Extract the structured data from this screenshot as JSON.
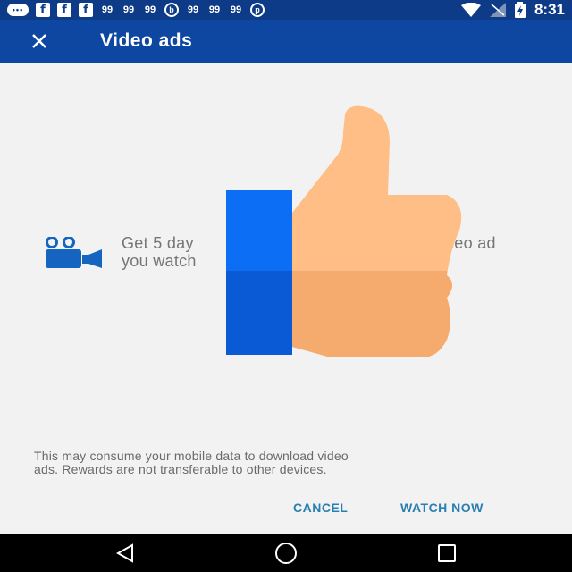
{
  "status_bar": {
    "time": "8:31",
    "icons": [
      "chat-icon",
      "facebook-icon",
      "facebook-icon",
      "facebook-icon",
      "app-icon",
      "app-icon",
      "app-icon",
      "b-icon",
      "app-icon",
      "app-icon",
      "app-icon",
      "pinterest-icon",
      "wifi-icon",
      "signal-icon",
      "battery-icon"
    ]
  },
  "app_bar": {
    "title": "Video ads",
    "close_icon": "close-icon",
    "background": "#0d47a1"
  },
  "offer": {
    "icon": "video-camera-icon",
    "line1": "Get 5 day",
    "line2": "you watch",
    "line1_end": "deo ad"
  },
  "overlay": {
    "icon": "thumbs-up-icon"
  },
  "disclaimer": {
    "line1": "This may consume your mobile data to download video",
    "line2": "ads. Rewards are not transferable to other devices."
  },
  "actions": {
    "cancel_label": "CANCEL",
    "watch_label": "WATCH NOW",
    "accent": "#2a7fb2"
  },
  "nav_bar": {
    "icons": [
      "back-icon",
      "home-icon",
      "recents-icon"
    ]
  }
}
